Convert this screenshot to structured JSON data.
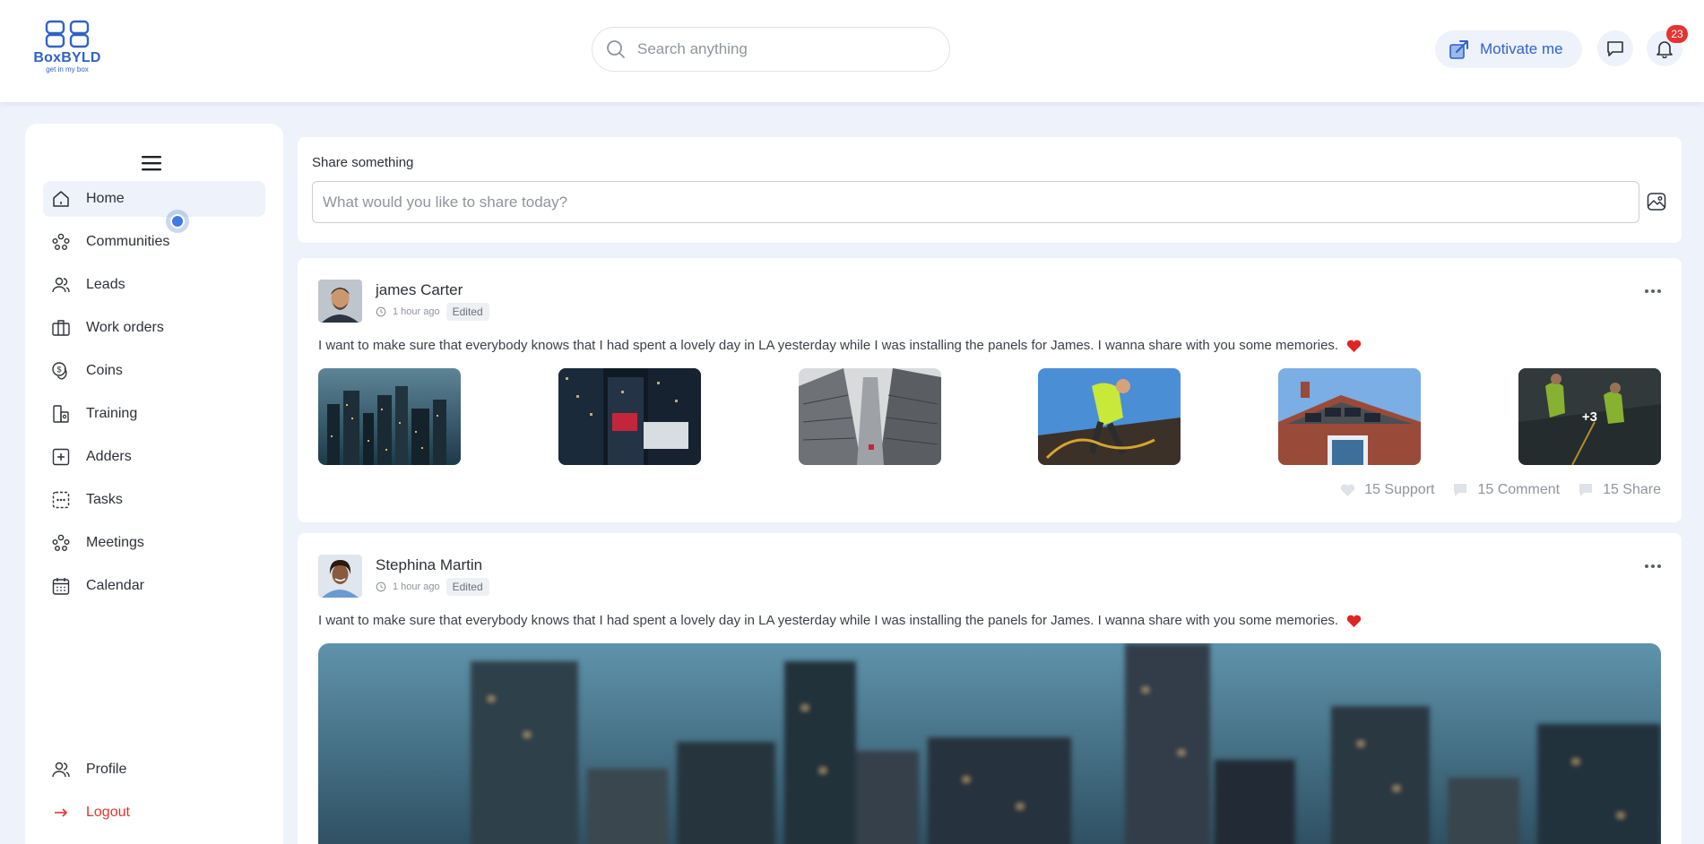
{
  "brand": {
    "name": "BoxBYLD",
    "tagline": "get in my box",
    "color": "#2f62c9"
  },
  "header": {
    "search_placeholder": "Search anything",
    "motivate_label": "Motivate me",
    "notification_count": "23",
    "icons": [
      "search-icon",
      "motivate-icon",
      "chat-icon",
      "bell-icon"
    ]
  },
  "sidebar": {
    "items": [
      {
        "label": "Home",
        "icon": "home-icon",
        "active": true
      },
      {
        "label": "Communities",
        "icon": "communities-icon"
      },
      {
        "label": "Leads",
        "icon": "leads-icon"
      },
      {
        "label": "Work orders",
        "icon": "briefcase-icon"
      },
      {
        "label": "Coins",
        "icon": "coins-icon"
      },
      {
        "label": "Training",
        "icon": "training-icon"
      },
      {
        "label": "Adders",
        "icon": "plus-square-icon"
      },
      {
        "label": "Tasks",
        "icon": "tasks-icon"
      },
      {
        "label": "Meetings",
        "icon": "meetings-icon"
      },
      {
        "label": "Calendar",
        "icon": "calendar-icon"
      }
    ],
    "bottom": [
      {
        "label": "Profile",
        "icon": "profile-icon"
      },
      {
        "label": "Logout",
        "icon": "logout-arrow-icon"
      }
    ]
  },
  "share": {
    "title": "Share something",
    "placeholder": "What would you like to share today?"
  },
  "posts": [
    {
      "author": "james Carter",
      "time": "1 hour ago",
      "edited": "Edited",
      "text": "I want to make sure that everybody knows that I had spent a lovely day in LA yesterday while I was installing the panels for James. I wanna share with you some memories.",
      "extra_images": "+3",
      "actions": {
        "support": "15 Support",
        "comment": "15 Comment",
        "share": "15 Share"
      }
    },
    {
      "author": "Stephina Martin",
      "time": "1 hour ago",
      "edited": "Edited",
      "text": "I want to make sure that everybody knows that I had spent a lovely day in LA yesterday while I was installing the panels for James. I wanna share with you some memories."
    }
  ],
  "colors": {
    "accent": "#2f62c9",
    "background": "#eef2fa",
    "badge": "#e5332f",
    "heart": "#e02424",
    "logout": "#e5332f"
  }
}
